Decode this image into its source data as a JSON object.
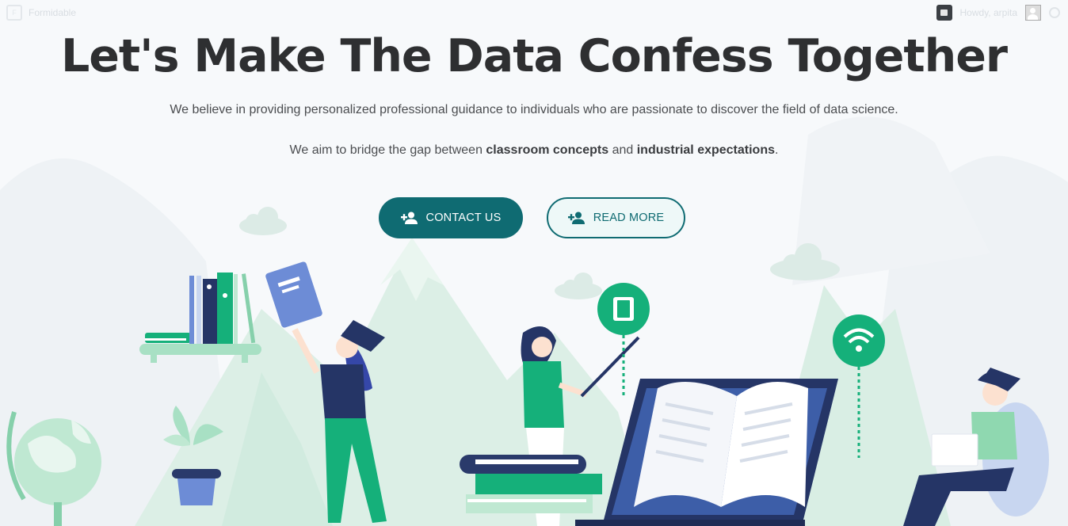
{
  "admin_bar": {
    "site_name": "Formidable",
    "greeting": "Howdy, arpita"
  },
  "hero": {
    "title": "Let's Make The Data Confess Together",
    "paragraph1": "We believe in providing personalized professional guidance to individuals who are passionate to discover the field of data science.",
    "paragraph2": {
      "pre": "We aim to bridge the gap between ",
      "bold1": "classroom concepts",
      "mid": " and ",
      "bold2": "industrial expectations",
      "post": "."
    }
  },
  "buttons": {
    "contact_label": "CONTACT US",
    "read_more_label": "READ MORE",
    "icon": "person-add-icon"
  },
  "colors": {
    "primary": "#0f6b72",
    "accent_green": "#15b07a",
    "navy": "#2a3a6b",
    "mint": "#bfe8d2"
  }
}
